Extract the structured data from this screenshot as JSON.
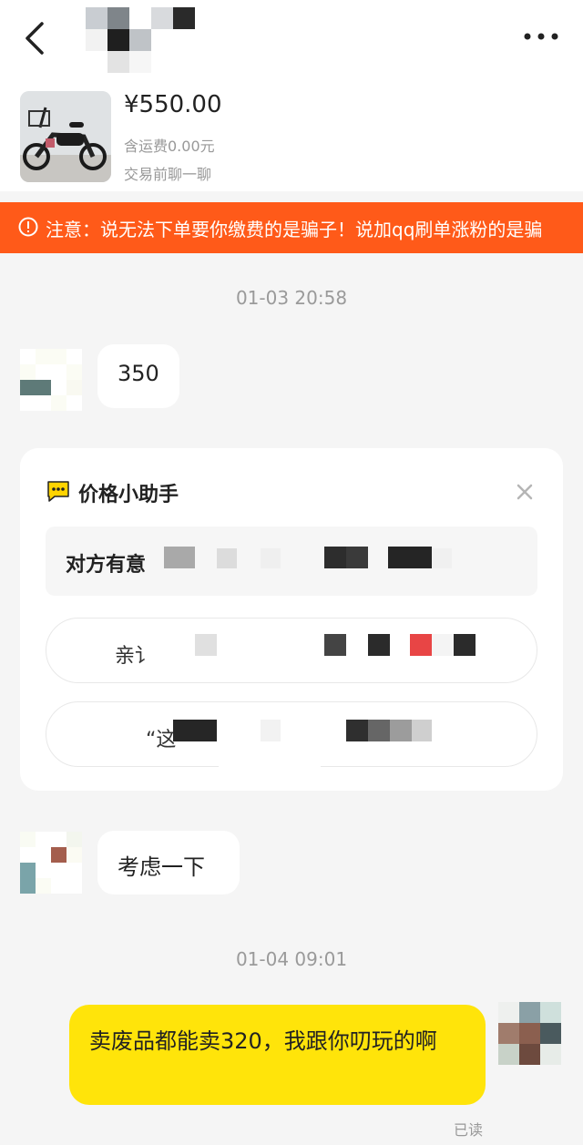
{
  "header": {
    "product": {
      "price": "¥550.00",
      "shipping": "含运费0.00元",
      "chat_hint": "交易前聊一聊"
    }
  },
  "warning": {
    "text": "注意：说无法下单要你缴费的是骗子！说加qq刷单涨粉的是骗"
  },
  "messages": [
    {
      "type": "timestamp",
      "text": "01-03 20:58"
    },
    {
      "type": "incoming",
      "text": "350"
    },
    {
      "type": "incoming",
      "text": "考虑一下"
    },
    {
      "type": "timestamp",
      "text": "01-04 09:01"
    },
    {
      "type": "outgoing",
      "text": "卖废品都能卖320，我跟你叨玩的啊",
      "status": "已读"
    }
  ],
  "price_helper": {
    "title": "价格小助手",
    "question_visible": "对方有意",
    "option1_visible": "亲讠",
    "option2_visible": "“这"
  },
  "colors": {
    "warning_bar": "#ff5a19",
    "my_bubble": "#ffe40a",
    "background": "#f5f5f5"
  },
  "icons": [
    "back-arrow-icon",
    "more-dots-icon",
    "warning-circle-icon",
    "chat-bubble-icon",
    "close-icon"
  ]
}
